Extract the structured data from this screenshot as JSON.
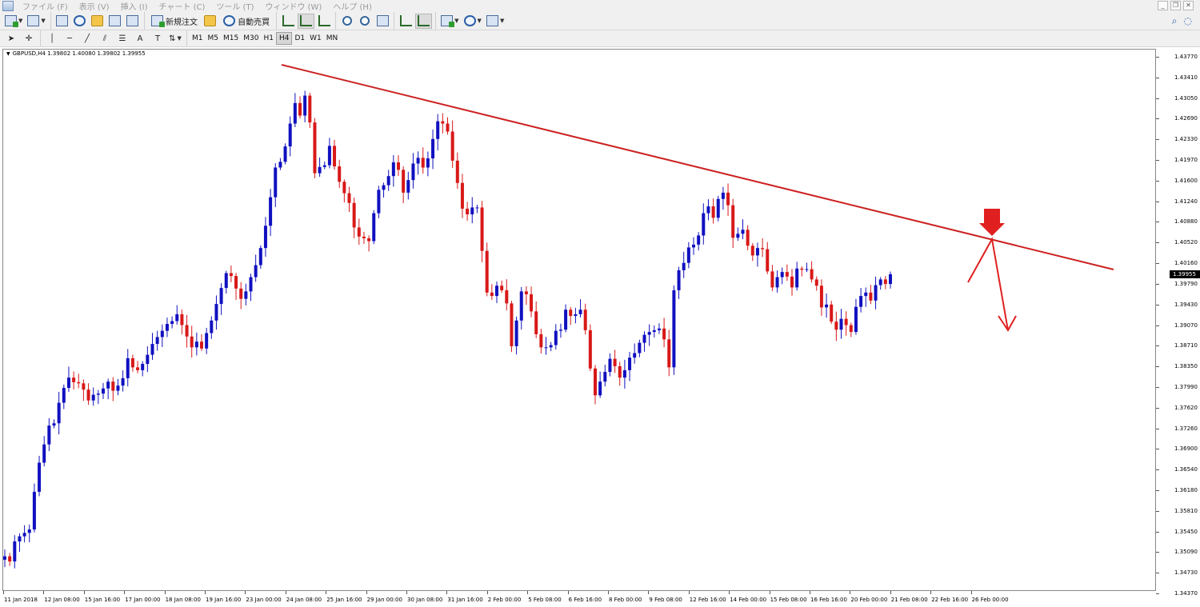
{
  "menu": {
    "items": [
      "ファイル (F)",
      "表示 (V)",
      "挿入 (I)",
      "チャート (C)",
      "ツール (T)",
      "ウィンドウ (W)",
      "ヘルプ (H)"
    ]
  },
  "window_controls": [
    "_",
    "❐",
    "✕"
  ],
  "toolbar1": {
    "new_order_label": "新規注文",
    "auto_trade_label": "自動売買"
  },
  "timeframes": [
    "M1",
    "M5",
    "M15",
    "M30",
    "H1",
    "H4",
    "D1",
    "W1",
    "MN"
  ],
  "active_timeframe": "H4",
  "chart": {
    "symbol_info": "GBPUSD,H4  1.39802 1.40080 1.39802 1.39955",
    "current_price": "1.39955",
    "price_labels": [
      "1.43770",
      "1.43410",
      "1.43050",
      "1.42690",
      "1.42330",
      "1.41970",
      "1.41600",
      "1.41240",
      "1.40880",
      "1.40520",
      "1.40160",
      "1.39790",
      "1.39430",
      "1.39070",
      "1.38710",
      "1.38350",
      "1.37990",
      "1.37620",
      "1.37260",
      "1.36900",
      "1.36540",
      "1.36180",
      "1.35810",
      "1.35450",
      "1.35090",
      "1.34730",
      "1.34370"
    ],
    "time_labels": [
      "11 Jan 2018",
      "12 Jan 08:00",
      "15 Jan 16:00",
      "17 Jan 00:00",
      "18 Jan 08:00",
      "19 Jan 16:00",
      "23 Jan 00:00",
      "24 Jan 08:00",
      "25 Jan 16:00",
      "29 Jan 00:00",
      "30 Jan 08:00",
      "31 Jan 16:00",
      "2 Feb 00:00",
      "5 Feb 08:00",
      "6 Feb 16:00",
      "8 Feb 00:00",
      "9 Feb 08:00",
      "12 Feb 16:00",
      "14 Feb 00:00",
      "15 Feb 08:00",
      "16 Feb 16:00",
      "20 Feb 00:00",
      "21 Feb 08:00",
      "22 Feb 16:00",
      "26 Feb 00:00"
    ],
    "colors": {
      "bull": "#1010c0",
      "bear": "#d81818",
      "trendline": "#cc2222",
      "arrow": "#e02020"
    }
  },
  "chart_data": {
    "type": "candlestick",
    "symbol": "GBPUSD",
    "timeframe": "H4",
    "ylim": [
      1.3437,
      1.4377
    ],
    "closes": [
      1.3502,
      1.3493,
      1.3528,
      1.3537,
      1.3543,
      1.3549,
      1.3615,
      1.3666,
      1.3698,
      1.3731,
      1.3735,
      1.3771,
      1.3797,
      1.3815,
      1.3807,
      1.3805,
      1.3794,
      1.3775,
      1.3785,
      1.3787,
      1.3796,
      1.3808,
      1.3792,
      1.3801,
      1.3814,
      1.3849,
      1.3833,
      1.3828,
      1.3839,
      1.3855,
      1.3874,
      1.3886,
      1.3897,
      1.3909,
      1.3914,
      1.3926,
      1.3907,
      1.3887,
      1.3868,
      1.3878,
      1.3866,
      1.3893,
      1.3915,
      1.3944,
      1.3972,
      1.3998,
      1.3993,
      1.3971,
      1.3953,
      1.3966,
      1.3991,
      1.4012,
      1.4042,
      1.4081,
      1.4131,
      1.4183,
      1.4193,
      1.422,
      1.426,
      1.4296,
      1.4274,
      1.4309,
      1.4262,
      1.4173,
      1.4184,
      1.4187,
      1.4221,
      1.4185,
      1.4158,
      1.4138,
      1.4121,
      1.4078,
      1.4062,
      1.4059,
      1.4054,
      1.4103,
      1.4144,
      1.4152,
      1.4168,
      1.4192,
      1.4179,
      1.4139,
      1.4161,
      1.419,
      1.42,
      1.4183,
      1.4199,
      1.4233,
      1.4264,
      1.426,
      1.4246,
      1.4195,
      1.4156,
      1.4111,
      1.4101,
      1.4113,
      1.4113,
      1.4037,
      1.3964,
      1.3958,
      1.3976,
      1.3968,
      1.3945,
      1.387,
      1.3915,
      1.3966,
      1.3961,
      1.3931,
      1.3891,
      1.3868,
      1.3868,
      1.3872,
      1.3897,
      1.3899,
      1.3934,
      1.3923,
      1.3926,
      1.3934,
      1.3898,
      1.3831,
      1.3784,
      1.3808,
      1.3825,
      1.3848,
      1.3835,
      1.3815,
      1.3828,
      1.385,
      1.3858,
      1.3876,
      1.389,
      1.3895,
      1.3898,
      1.3901,
      1.3882,
      1.3833,
      1.3968,
      1.4003,
      1.4016,
      1.4043,
      1.4048,
      1.4064,
      1.4103,
      1.4115,
      1.4095,
      1.4128,
      1.4139,
      1.4117,
      1.406,
      1.4067,
      1.4074,
      1.4046,
      1.4029,
      1.4042,
      1.404,
      1.4001,
      1.3973,
      1.3991,
      1.4,
      1.3992,
      1.3973,
      1.4006,
      1.4004,
      1.4005,
      1.3987,
      1.3976,
      1.3938,
      1.3943,
      1.3913,
      1.3899,
      1.3918,
      1.3907,
      1.3895,
      1.3939,
      1.3958,
      1.3964,
      1.395,
      1.3977,
      1.3987,
      1.3979,
      1.3996
    ],
    "trendline": {
      "start": {
        "x": "24 Jan",
        "y": 1.4368
      },
      "end": {
        "x": "26 Feb",
        "y": 1.4003
      }
    },
    "annotations": [
      "down arrow marking trendline touch",
      "projected downward arrow"
    ]
  }
}
